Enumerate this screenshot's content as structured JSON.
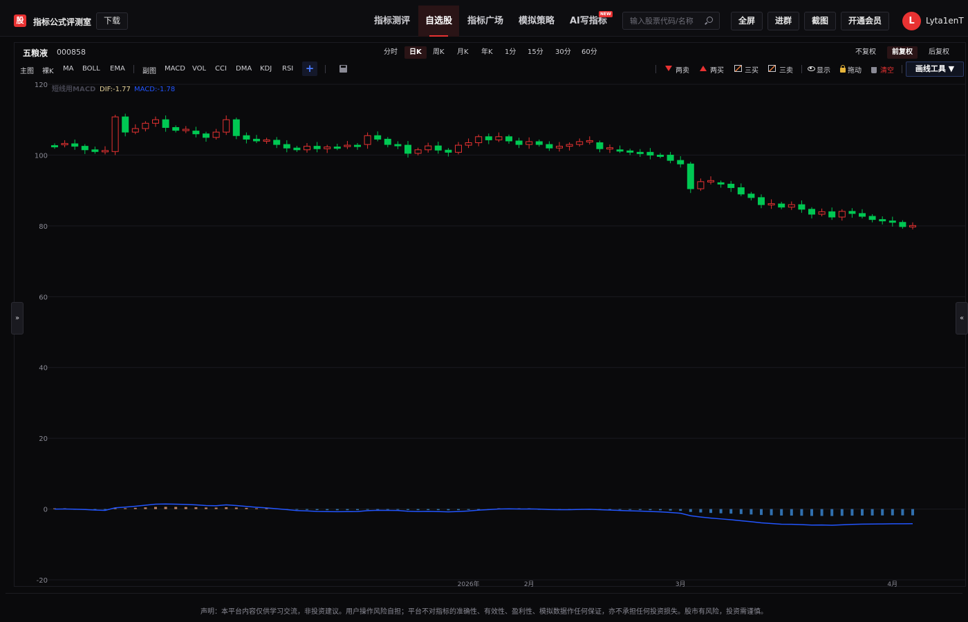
{
  "header": {
    "logo_char": "股",
    "app_title": "指标公式评测室",
    "download_label": "下载",
    "nav": [
      {
        "label": "指标测评",
        "active": false
      },
      {
        "label": "自选股",
        "active": true
      },
      {
        "label": "指标广场",
        "active": false
      },
      {
        "label": "模拟策略",
        "active": false
      },
      {
        "label": "AI写指标",
        "active": false,
        "badge": "NEW"
      }
    ],
    "search_placeholder": "输入股票代码/名称",
    "buttons": [
      "全屏",
      "进群",
      "截图",
      "开通会员"
    ],
    "user": {
      "avatar_letter": "L",
      "name": "Lyta1enT"
    }
  },
  "stock": {
    "name": "五粮液",
    "code": "000858"
  },
  "periods": [
    {
      "label": "分时",
      "active": false
    },
    {
      "label": "日K",
      "active": true
    },
    {
      "label": "周K",
      "active": false
    },
    {
      "label": "月K",
      "active": false
    },
    {
      "label": "年K",
      "active": false
    },
    {
      "label": "1分",
      "active": false
    },
    {
      "label": "15分",
      "active": false
    },
    {
      "label": "30分",
      "active": false
    },
    {
      "label": "60分",
      "active": false
    }
  ],
  "fuquan": [
    {
      "label": "不复权",
      "active": false
    },
    {
      "label": "前复权",
      "active": true
    },
    {
      "label": "后复权",
      "active": false
    }
  ],
  "indicators": {
    "main_label": "主图",
    "main": [
      "裸K",
      "MA",
      "BOLL",
      "EMA"
    ],
    "sub_label": "副图",
    "sub": [
      "MACD",
      "VOL",
      "CCI",
      "DMA",
      "KDJ",
      "RSI"
    ],
    "add_label": "+"
  },
  "tools": {
    "sell2": "两卖",
    "buy2": "两买",
    "buy3": "三买",
    "sell3": "三卖",
    "show": "显示",
    "drag": "拖动",
    "clear": "清空",
    "draw_tools": "画线工具 ▼"
  },
  "colors": {
    "up": "#e83232",
    "down": "#00c853",
    "dif": "#2255ff",
    "accent": "#e83232"
  },
  "chart_data": {
    "type": "candlestick",
    "indicator_label": "短线用MACD",
    "dif_label": "DIF:-1.77",
    "macd_label": "MACD:-1.78",
    "ylim": [
      -20,
      120
    ],
    "yticks": [
      120,
      100,
      80,
      60,
      40,
      20,
      0,
      -20
    ],
    "xtick_labels": [
      "2026年",
      "2月",
      "3月",
      "4月"
    ],
    "xtick_indices": [
      41,
      47,
      62,
      83
    ],
    "closes": [
      103.0,
      103.2,
      102.5,
      101.5,
      101.0,
      101.0,
      110.8,
      106.5,
      107.5,
      109.0,
      110.0,
      107.8,
      107.0,
      106.8,
      106.0,
      105.0,
      106.5,
      110.0,
      105.5,
      104.5,
      104.0,
      104.2,
      103.0,
      102.0,
      101.5,
      102.5,
      101.8,
      102.3,
      102.5,
      102.8,
      103.0,
      105.5,
      104.5,
      103.0,
      102.8,
      100.5,
      101.5,
      102.6,
      101.4,
      100.8,
      102.8,
      103.5,
      105.2,
      104.3,
      105.2,
      104.0,
      103.0,
      103.8,
      103.0,
      102.0,
      102.5,
      103.0,
      103.8,
      103.5,
      101.8,
      101.5,
      101.2,
      100.8,
      100.8,
      100.0,
      100.0,
      98.5,
      97.5,
      90.5,
      92.5,
      92.2,
      91.8,
      90.8,
      89.0,
      88.0,
      86.0,
      86.2,
      85.3,
      86.0,
      84.7,
      83.3,
      84.0,
      82.5,
      84.1,
      83.5,
      82.7,
      81.8,
      81.4,
      81.0,
      79.8,
      79.5
    ],
    "series": [
      {
        "name": "DIF",
        "value": -1.77
      },
      {
        "name": "MACD",
        "value": -1.78
      }
    ]
  },
  "footer": {
    "disclaimer": "声明：本平台内容仅供学习交流，非投资建议。用户操作风险自担；平台不对指标的准确性、有效性、盈利性、模拟数据作任何保证，亦不承担任何投资损失。股市有风险，投资需谨慎。"
  }
}
